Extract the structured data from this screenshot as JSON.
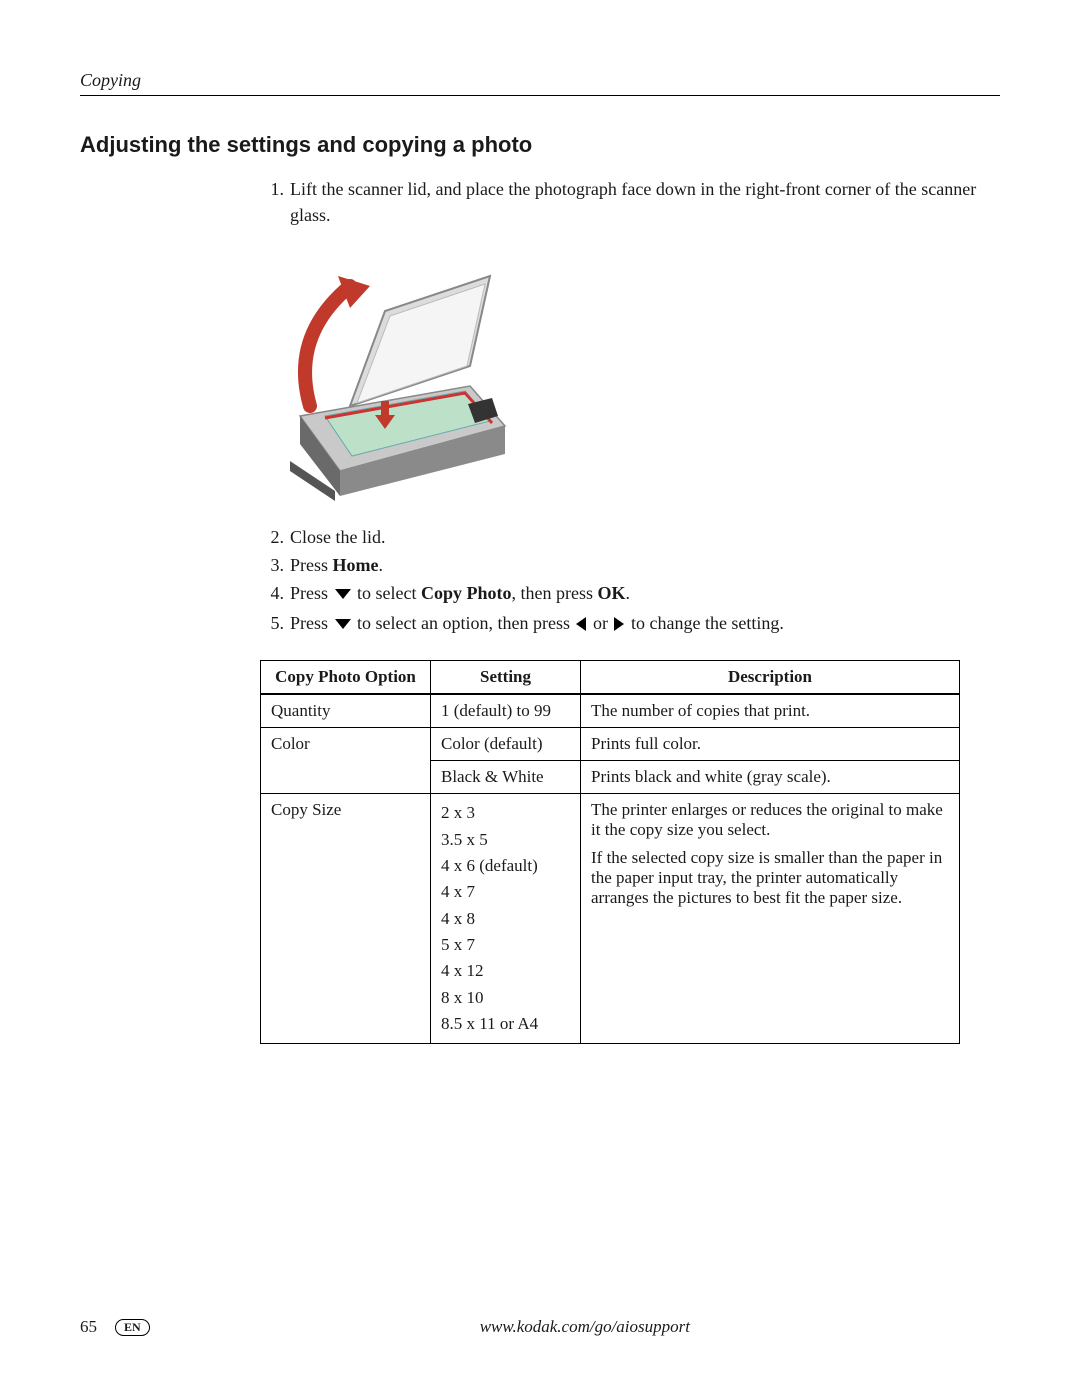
{
  "section": "Copying",
  "heading": "Adjusting the settings and copying a photo",
  "steps": {
    "s1": "Lift the scanner lid, and place the photograph face down in the right-front corner of the scanner glass.",
    "s2": "Close the lid.",
    "s3_pre": "Press ",
    "s3_b": "Home",
    "s3_post": ".",
    "s4_pre": "Press ",
    "s4_mid": " to select ",
    "s4_b": "Copy Photo",
    "s4_mid2": ", then press ",
    "s4_b2": "OK",
    "s4_post": ".",
    "s5_pre": "Press ",
    "s5_mid": " to select an option, then press ",
    "s5_mid2": " or ",
    "s5_post": " to change the setting."
  },
  "table": {
    "headers": {
      "opt": "Copy Photo Option",
      "set": "Setting",
      "desc": "Description"
    },
    "rows": {
      "quantity": {
        "opt": "Quantity",
        "set": "1 (default) to 99",
        "desc": "The number of copies that print."
      },
      "color1": {
        "opt": "Color",
        "set": "Color (default)",
        "desc": "Prints full color."
      },
      "color2": {
        "set": "Black & White",
        "desc": "Prints black and white (gray scale)."
      },
      "size": {
        "opt": "Copy Size",
        "sizes": [
          "2 x 3",
          "3.5 x 5",
          "4 x 6 (default)",
          "4 x 7",
          "4 x 8",
          "5 x 7",
          "4 x 12",
          "8 x 10",
          "8.5 x 11 or A4"
        ],
        "desc1": "The printer enlarges or reduces the original to make it the copy size you select.",
        "desc2": "If the selected copy size is smaller than the paper in the paper input tray, the printer automatically arranges the pictures to best fit the paper size."
      }
    }
  },
  "footer": {
    "page": "65",
    "lang": "EN",
    "url": "www.kodak.com/go/aiosupport"
  }
}
